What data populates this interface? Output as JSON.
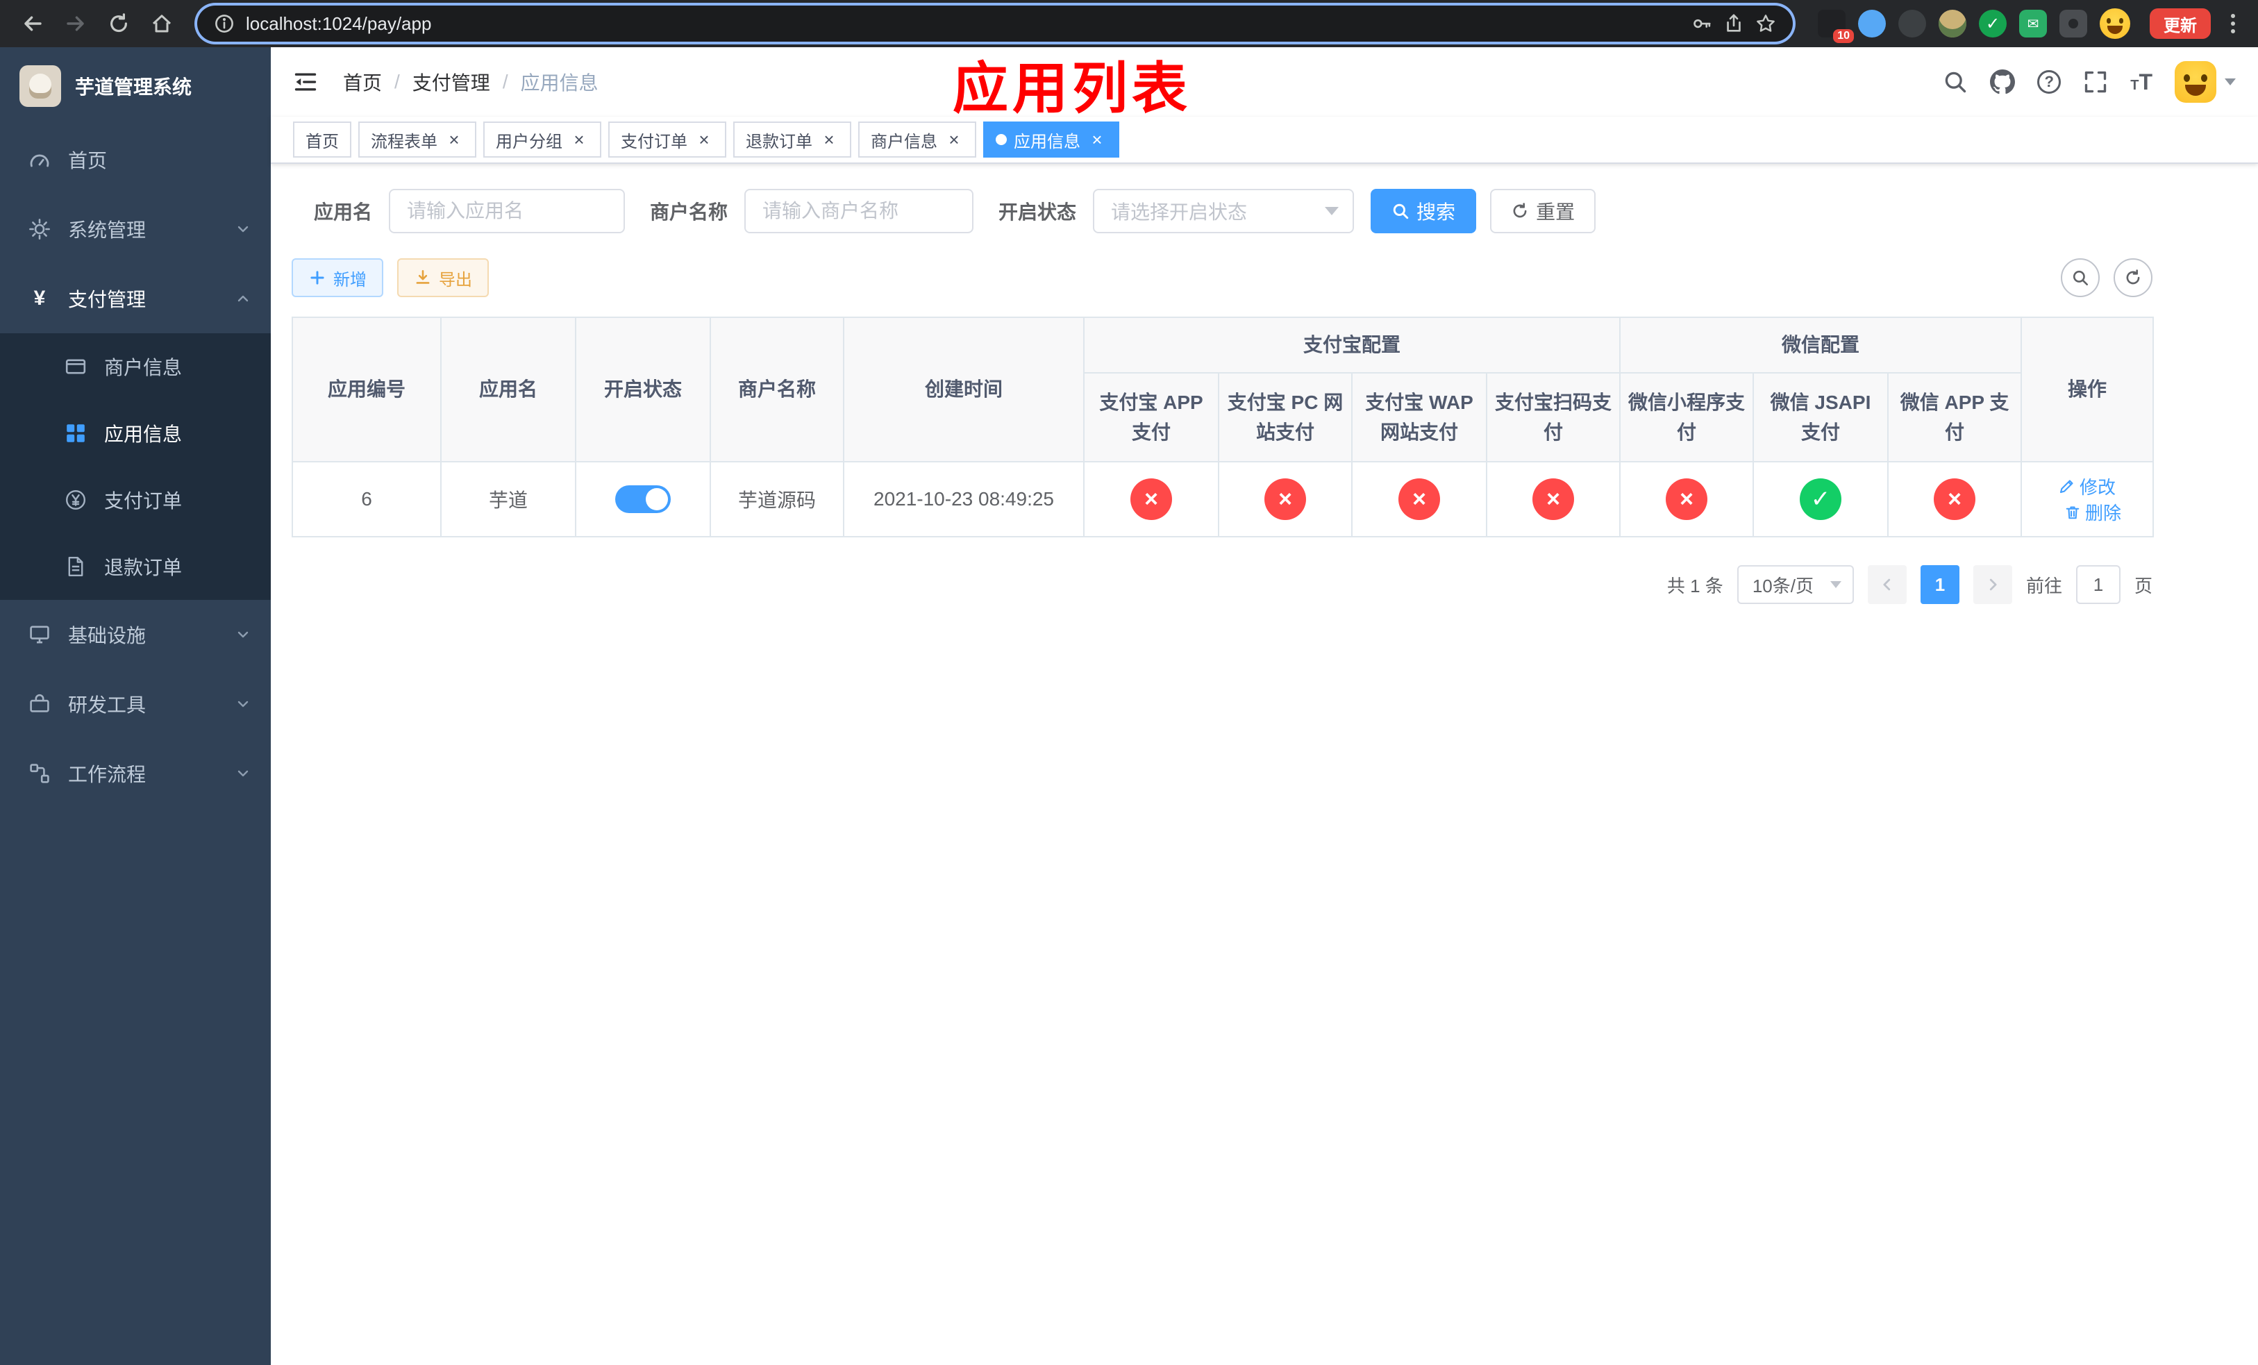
{
  "colors": {
    "accent": "#409eff",
    "success": "#13ce66",
    "danger": "#ff4949",
    "warning": "#e6a23c",
    "title-red": "#ff0000",
    "update-red": "#e8453c",
    "sidebar-bg": "#304156",
    "submenu-bg": "#1f2d3d",
    "sidebar-text": "#bfcbd9",
    "browser-bg": "#26282b",
    "address-bg": "#1b1c1e",
    "focus-ring": "#8ab4f8",
    "tag-border": "#d8dce5",
    "table-border": "#dfe6ec",
    "table-header-bg": "#f8f8f9"
  },
  "browser": {
    "url": "localhost:1024/pay/app",
    "update_label": "更新",
    "extension_badge": "10"
  },
  "sidebar": {
    "logo_title": "芋道管理系统",
    "items": {
      "home": "首页",
      "system": "系统管理",
      "payment": "支付管理",
      "infra": "基础设施",
      "devtools": "研发工具",
      "workflow": "工作流程"
    },
    "payment_children": {
      "merchant": "商户信息",
      "app": "应用信息",
      "order": "支付订单",
      "refund": "退款订单"
    }
  },
  "header": {
    "breadcrumb": [
      "首页",
      "支付管理",
      "应用信息"
    ],
    "overlay_title": "应用列表"
  },
  "tags": [
    {
      "label": "首页"
    },
    {
      "label": "流程表单"
    },
    {
      "label": "用户分组"
    },
    {
      "label": "支付订单"
    },
    {
      "label": "退款订单"
    },
    {
      "label": "商户信息"
    },
    {
      "label": "应用信息"
    }
  ],
  "filters": {
    "app_name_label": "应用名",
    "app_name_placeholder": "请输入应用名",
    "merchant_label": "商户名称",
    "merchant_placeholder": "请输入商户名称",
    "status_label": "开启状态",
    "status_placeholder": "请选择开启状态",
    "search_label": "搜索",
    "reset_label": "重置"
  },
  "toolbar": {
    "add_label": "新增",
    "export_label": "导出"
  },
  "table": {
    "headers": {
      "app_id": "应用编号",
      "app_name": "应用名",
      "status": "开启状态",
      "merchant": "商户名称",
      "created": "创建时间",
      "alipay_group": "支付宝配置",
      "wechat_group": "微信配置",
      "alipay_app": "支付宝 APP 支付",
      "alipay_pc": "支付宝 PC 网站支付",
      "alipay_wap": "支付宝 WAP 网站支付",
      "alipay_qr": "支付宝扫码支付",
      "wx_lite": "微信小程序支付",
      "wx_jsapi": "微信 JSAPI 支付",
      "wx_app": "微信 APP 支付",
      "actions": "操作"
    },
    "rows": [
      {
        "app_id": "6",
        "app_name": "芋道",
        "enabled": true,
        "merchant": "芋道源码",
        "created": "2021-10-23 08:49:25",
        "alipay_app": false,
        "alipay_pc": false,
        "alipay_wap": false,
        "alipay_qr": false,
        "wx_lite": false,
        "wx_jsapi": true,
        "wx_app": false,
        "edit_label": "修改",
        "delete_label": "删除"
      }
    ]
  },
  "pagination": {
    "total": "共 1 条",
    "page_size": "10条/页",
    "current_page": "1",
    "goto_label": "前往",
    "goto_value": "1",
    "page_unit": "页"
  }
}
